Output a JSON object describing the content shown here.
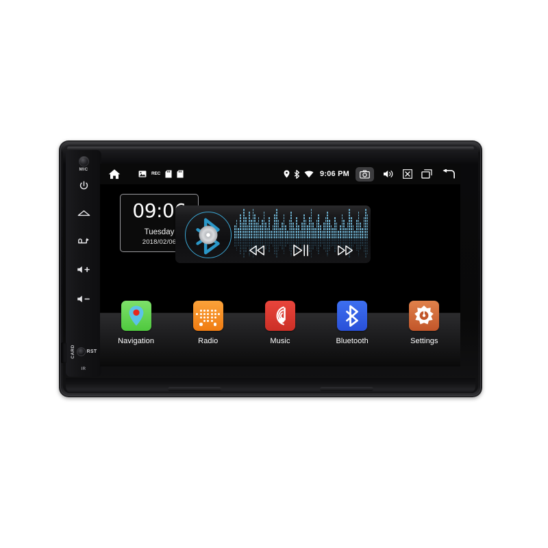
{
  "device": {
    "type": "car-head-unit",
    "bezel": {
      "mic_label": "MIC",
      "card_label": "CARD",
      "reset_label": "RST",
      "ir_label": "IR",
      "buttons": [
        {
          "name": "power",
          "icon": "power-icon"
        },
        {
          "name": "home",
          "icon": "home-icon"
        },
        {
          "name": "mode",
          "icon": "mode-return-icon"
        },
        {
          "name": "volume-up",
          "icon": "volume-up-icon"
        },
        {
          "name": "volume-down",
          "icon": "volume-down-icon"
        }
      ]
    }
  },
  "statusbar": {
    "left_icons": [
      {
        "name": "home-icon",
        "label": ""
      },
      {
        "name": "gallery-icon",
        "label": ""
      },
      {
        "name": "rec-badge",
        "label": "REC"
      },
      {
        "name": "sd-card-icon-1",
        "label": ""
      },
      {
        "name": "sd-card-icon-2",
        "label": ""
      }
    ],
    "status_icons": [
      {
        "name": "location-pin-icon"
      },
      {
        "name": "bluetooth-icon"
      },
      {
        "name": "wifi-icon"
      }
    ],
    "time": "9:06 PM",
    "nav_icons": [
      {
        "name": "camera-icon",
        "active": true
      },
      {
        "name": "volume-icon",
        "active": false
      },
      {
        "name": "close-x-icon",
        "active": false
      },
      {
        "name": "recents-icon",
        "active": false
      },
      {
        "name": "back-icon",
        "active": false
      }
    ]
  },
  "home": {
    "clock_widget": {
      "time": "09:06",
      "weekday": "Tuesday",
      "date": "2018/02/06"
    },
    "music_widget": {
      "source_icon": "bluetooth-disc-icon",
      "prev_label": "",
      "play_pause_label": "",
      "next_label": "",
      "spectrum_levels": [
        5,
        7,
        4,
        9,
        6,
        11,
        8,
        5,
        10,
        7,
        12,
        9,
        6,
        8,
        5,
        7,
        10,
        6,
        4,
        8,
        3,
        5,
        9,
        12,
        7,
        4,
        6,
        9,
        5,
        3,
        7,
        10,
        6,
        4,
        8,
        5,
        3,
        6,
        9,
        7,
        5,
        8,
        11,
        6,
        4,
        7,
        9,
        5,
        3,
        6,
        8,
        10,
        7,
        5,
        4,
        8,
        6,
        3,
        5,
        9,
        7,
        4,
        6,
        11,
        8,
        5,
        3,
        7,
        10,
        6,
        4,
        8,
        12,
        9
      ]
    },
    "apps": [
      {
        "label": "Navigation",
        "icon": "map-pin-icon",
        "color": "#4fc93f"
      },
      {
        "label": "Radio",
        "icon": "radio-dots-icon",
        "color": "#f07c12"
      },
      {
        "label": "Music",
        "icon": "music-note-icon",
        "color": "#cc2f26"
      },
      {
        "label": "Bluetooth",
        "icon": "bluetooth-icon",
        "color": "#2950d8"
      },
      {
        "label": "Settings",
        "icon": "gear-icon",
        "color": "#c2562a"
      }
    ]
  },
  "colors": {
    "accent_cyan": "#3ba8d6",
    "spectrum": "#6aa9c6",
    "screen_bg": "#000000",
    "statusbar_bg": "#0a0a0a"
  }
}
